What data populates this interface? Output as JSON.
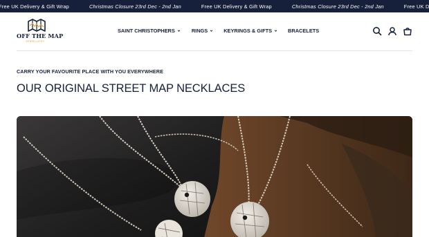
{
  "announcement": {
    "items": [
      {
        "text": "Free UK Delivery & Gift Wrap",
        "italic": false
      },
      {
        "text": "Christmas Closure 23rd Dec - 2nd Jan",
        "italic": true
      },
      {
        "text": "Free UK Delivery & Gift Wrap",
        "italic": false
      },
      {
        "text": "Christmas Closure 23rd Dec - 2nd Jan",
        "italic": true
      },
      {
        "text": "Free UK Delivery & Gift Wrap",
        "italic": false
      }
    ]
  },
  "header": {
    "logo": {
      "name": "OFF THE MAP",
      "sub": "JEWELLERY"
    },
    "nav": [
      {
        "label": "SAINT CHRISTOPHERS",
        "has_dropdown": true
      },
      {
        "label": "RINGS",
        "has_dropdown": true
      },
      {
        "label": "KEYRINGS & GIFTS",
        "has_dropdown": true
      },
      {
        "label": "BRACELETS",
        "has_dropdown": false
      }
    ],
    "icons": [
      "search-icon",
      "account-icon",
      "cart-icon"
    ]
  },
  "main": {
    "eyebrow": "CARRY YOUR FAVOURITE PLACE WITH YOU EVERYWHERE",
    "title": "OUR ORIGINAL STREET MAP NECKLACES"
  },
  "colors": {
    "navy": "#17203a",
    "gold": "#e1a33b",
    "announcement_bg": "#17203a"
  }
}
